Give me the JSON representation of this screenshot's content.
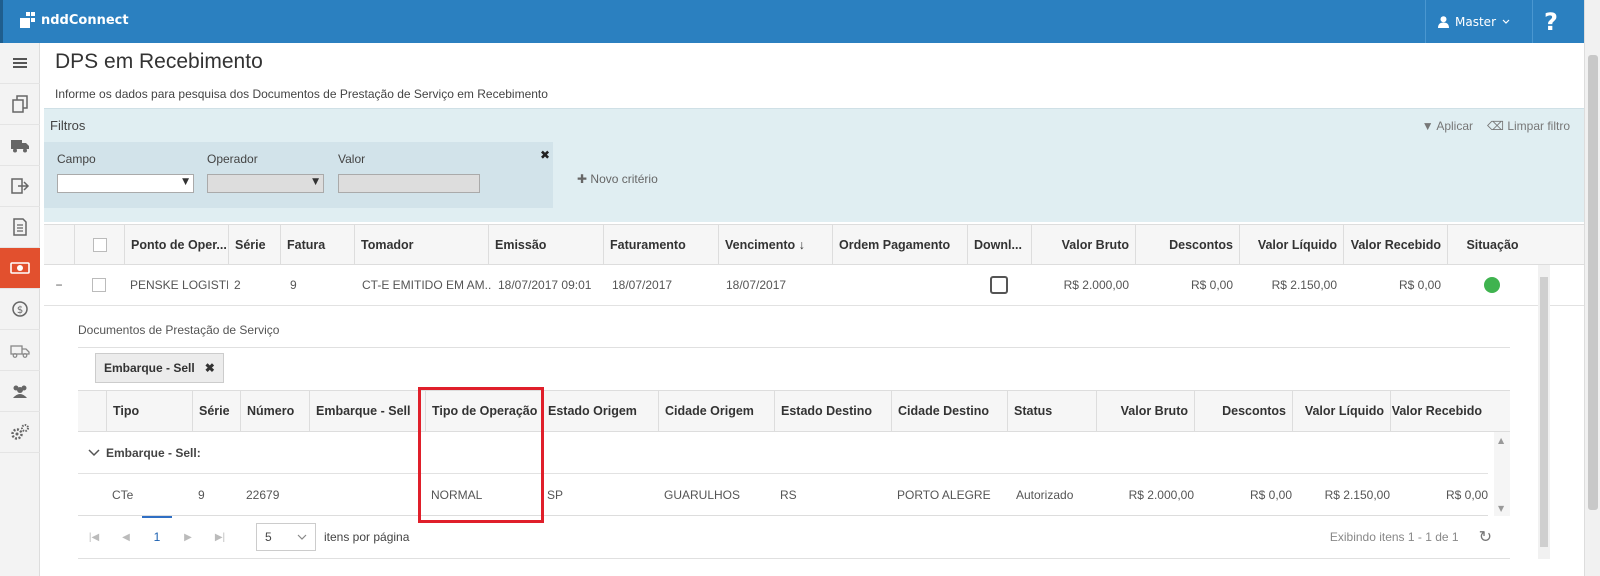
{
  "app": {
    "name": "nddConnect",
    "user": "Master",
    "help": "?"
  },
  "sidebar": {
    "items": [
      {
        "icon": "hamburger-icon",
        "active": false
      },
      {
        "icon": "documents-icon",
        "active": false
      },
      {
        "icon": "truck-icon",
        "active": false
      },
      {
        "icon": "export-icon",
        "active": false
      },
      {
        "icon": "file-list-icon",
        "active": false
      },
      {
        "icon": "money-icon",
        "active": true
      },
      {
        "icon": "money-cycle-icon",
        "active": false
      },
      {
        "icon": "trucks-icon",
        "active": false
      },
      {
        "icon": "users-icon",
        "active": false
      },
      {
        "icon": "gears-icon",
        "active": false
      }
    ]
  },
  "page": {
    "title": "DPS em Recebimento",
    "subtitle": "Informe os dados para pesquisa dos Documentos de Prestação de Serviço em Recebimento"
  },
  "filters": {
    "title": "Filtros",
    "apply": "Aplicar",
    "clear": "Limpar filtro",
    "field_label": "Campo",
    "operator_label": "Operador",
    "value_label": "Valor",
    "field_value": "",
    "operator_value": "",
    "value_value": "",
    "new_criteria": "Novo critério"
  },
  "grid": {
    "columns": [
      "Ponto de Oper...",
      "Série",
      "Fatura",
      "Tomador",
      "Emissão",
      "Faturamento",
      "Vencimento ↓",
      "Ordem Pagamento",
      "Downl...",
      "Valor Bruto",
      "Descontos",
      "Valor Líquido",
      "Valor Recebido",
      "Situação"
    ],
    "row": {
      "ponto": "PENSKE LOGISTI...",
      "serie": "2",
      "fatura": "9",
      "tomador": "CT-E EMITIDO EM AM...",
      "emissao": "18/07/2017 09:01",
      "faturamento": "18/07/2017",
      "vencimento": "18/07/2017",
      "ordem": "",
      "valor_bruto": "R$ 2.000,00",
      "descontos": "R$ 0,00",
      "valor_liquido": "R$ 2.150,00",
      "valor_recebido": "R$ 0,00",
      "situacao_color": "#3fb34f"
    }
  },
  "detail": {
    "title": "Documentos de Prestação de Serviço",
    "group_chip": "Embarque - Sell",
    "columns": [
      "Tipo",
      "Série",
      "Número",
      "Embarque - Sell",
      "Tipo de Operação",
      "Estado Origem",
      "Cidade Origem",
      "Estado Destino",
      "Cidade Destino",
      "Status",
      "Valor Bruto",
      "Descontos",
      "Valor Líquido",
      "Valor Recebido"
    ],
    "group_label": "Embarque - Sell:",
    "row": {
      "tipo": "CTe",
      "serie": "9",
      "numero": "22679",
      "embarque": "",
      "tipo_operacao": "NORMAL",
      "estado_origem": "SP",
      "cidade_origem": "GUARULHOS",
      "estado_destino": "RS",
      "cidade_destino": "PORTO ALEGRE",
      "status": "Autorizado",
      "valor_bruto": "R$ 2.000,00",
      "descontos": "R$ 0,00",
      "valor_liquido": "R$ 2.150,00",
      "valor_recebido": "R$ 0,00"
    }
  },
  "pager": {
    "current_page": "1",
    "page_size": "5",
    "per_page_label": "itens por página",
    "info": "Exibindo itens 1 - 1 de 1"
  },
  "colors": {
    "topbar": "#2b80c0",
    "active_sidebar": "#e2502e",
    "highlight": "#e01f2a",
    "status_ok": "#3fb34f"
  }
}
